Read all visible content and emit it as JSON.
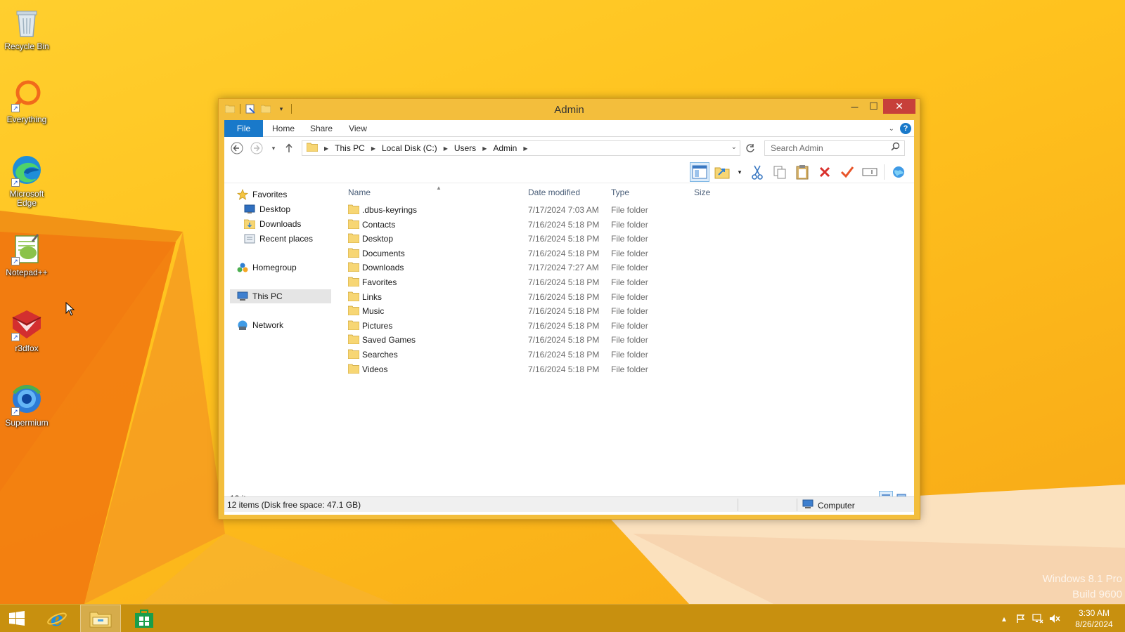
{
  "desktop": {
    "icons": [
      {
        "label": "Recycle Bin",
        "icon": "recycle-bin-icon"
      },
      {
        "label": "Everything",
        "icon": "everything-search-icon"
      },
      {
        "label": "Microsoft Edge",
        "icon": "edge-icon"
      },
      {
        "label": "Notepad++",
        "icon": "notepad-plus-plus-icon"
      },
      {
        "label": "r3dfox",
        "icon": "r3dfox-icon"
      },
      {
        "label": "Supermium",
        "icon": "supermium-icon"
      }
    ],
    "watermark": {
      "line1": "Windows 8.1 Pro",
      "line2": "Build 9600"
    }
  },
  "window": {
    "title": "Admin",
    "ribbon_tabs": [
      "File",
      "Home",
      "Share",
      "View"
    ],
    "breadcrumb": [
      "This PC",
      "Local Disk (C:)",
      "Users",
      "Admin"
    ],
    "search_placeholder": "Search Admin",
    "nav": {
      "favorites": "Favorites",
      "desktop": "Desktop",
      "downloads": "Downloads",
      "recent": "Recent places",
      "homegroup": "Homegroup",
      "this_pc": "This PC",
      "network": "Network"
    },
    "columns": {
      "name": "Name",
      "date": "Date modified",
      "type": "Type",
      "size": "Size"
    },
    "files": [
      {
        "name": ".dbus-keyrings",
        "date": "7/17/2024 7:03 AM",
        "type": "File folder"
      },
      {
        "name": "Contacts",
        "date": "7/16/2024 5:18 PM",
        "type": "File folder"
      },
      {
        "name": "Desktop",
        "date": "7/16/2024 5:18 PM",
        "type": "File folder"
      },
      {
        "name": "Documents",
        "date": "7/16/2024 5:18 PM",
        "type": "File folder"
      },
      {
        "name": "Downloads",
        "date": "7/17/2024 7:27 AM",
        "type": "File folder"
      },
      {
        "name": "Favorites",
        "date": "7/16/2024 5:18 PM",
        "type": "File folder"
      },
      {
        "name": "Links",
        "date": "7/16/2024 5:18 PM",
        "type": "File folder"
      },
      {
        "name": "Music",
        "date": "7/16/2024 5:18 PM",
        "type": "File folder"
      },
      {
        "name": "Pictures",
        "date": "7/16/2024 5:18 PM",
        "type": "File folder"
      },
      {
        "name": "Saved Games",
        "date": "7/16/2024 5:18 PM",
        "type": "File folder"
      },
      {
        "name": "Searches",
        "date": "7/16/2024 5:18 PM",
        "type": "File folder"
      },
      {
        "name": "Videos",
        "date": "7/16/2024 5:18 PM",
        "type": "File folder"
      }
    ],
    "item_count": "12 items",
    "status_left": "12 items (Disk free space: 47.1 GB)",
    "status_right": "Computer"
  },
  "taskbar": {
    "time": "3:30 AM",
    "date": "8/26/2024"
  },
  "colors": {
    "accent": "#1979ca",
    "window_frame": "#f3be3c",
    "taskbar": "#c8900f"
  }
}
